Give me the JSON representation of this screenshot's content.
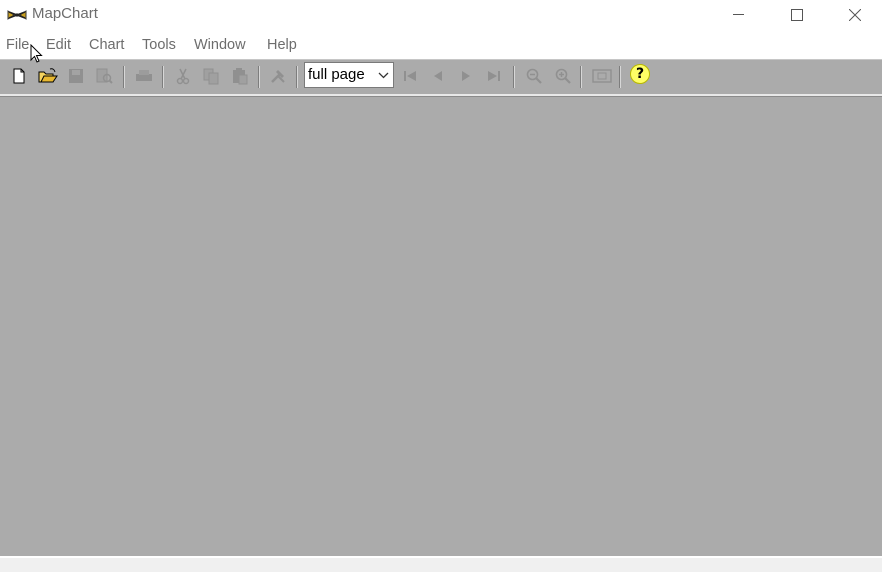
{
  "window": {
    "title": "MapChart",
    "icon": "mapchart-logo-icon",
    "controls": [
      "minimize-icon",
      "maximize-icon",
      "close-icon"
    ]
  },
  "menu": {
    "items": [
      "File",
      "Edit",
      "Chart",
      "Tools",
      "Window",
      "Help"
    ]
  },
  "toolbar": {
    "buttons": [
      {
        "icon": "new-document-icon",
        "enabled": true
      },
      {
        "icon": "open-folder-icon",
        "enabled": true
      },
      {
        "icon": "save-icon",
        "enabled": false
      },
      {
        "icon": "print-preview-icon",
        "enabled": false
      },
      {
        "icon": "print-icon",
        "enabled": false
      },
      {
        "icon": "cut-icon",
        "enabled": false
      },
      {
        "icon": "copy-icon",
        "enabled": false
      },
      {
        "icon": "paste-icon",
        "enabled": false
      },
      {
        "icon": "tools-icon",
        "enabled": false
      },
      {
        "icon": "first-page-icon",
        "enabled": false
      },
      {
        "icon": "previous-page-icon",
        "enabled": false
      },
      {
        "icon": "next-page-icon",
        "enabled": false
      },
      {
        "icon": "last-page-icon",
        "enabled": false
      },
      {
        "icon": "zoom-out-icon",
        "enabled": false
      },
      {
        "icon": "zoom-in-icon",
        "enabled": false
      },
      {
        "icon": "fit-page-icon",
        "enabled": false
      },
      {
        "icon": "help-icon",
        "enabled": true
      }
    ],
    "zoom": {
      "selected": "full page"
    },
    "help_glyph": "?"
  },
  "colors": {
    "workspace": "#ababab",
    "menu_text": "#6d6d6d",
    "disabled_icon": "#909090"
  }
}
